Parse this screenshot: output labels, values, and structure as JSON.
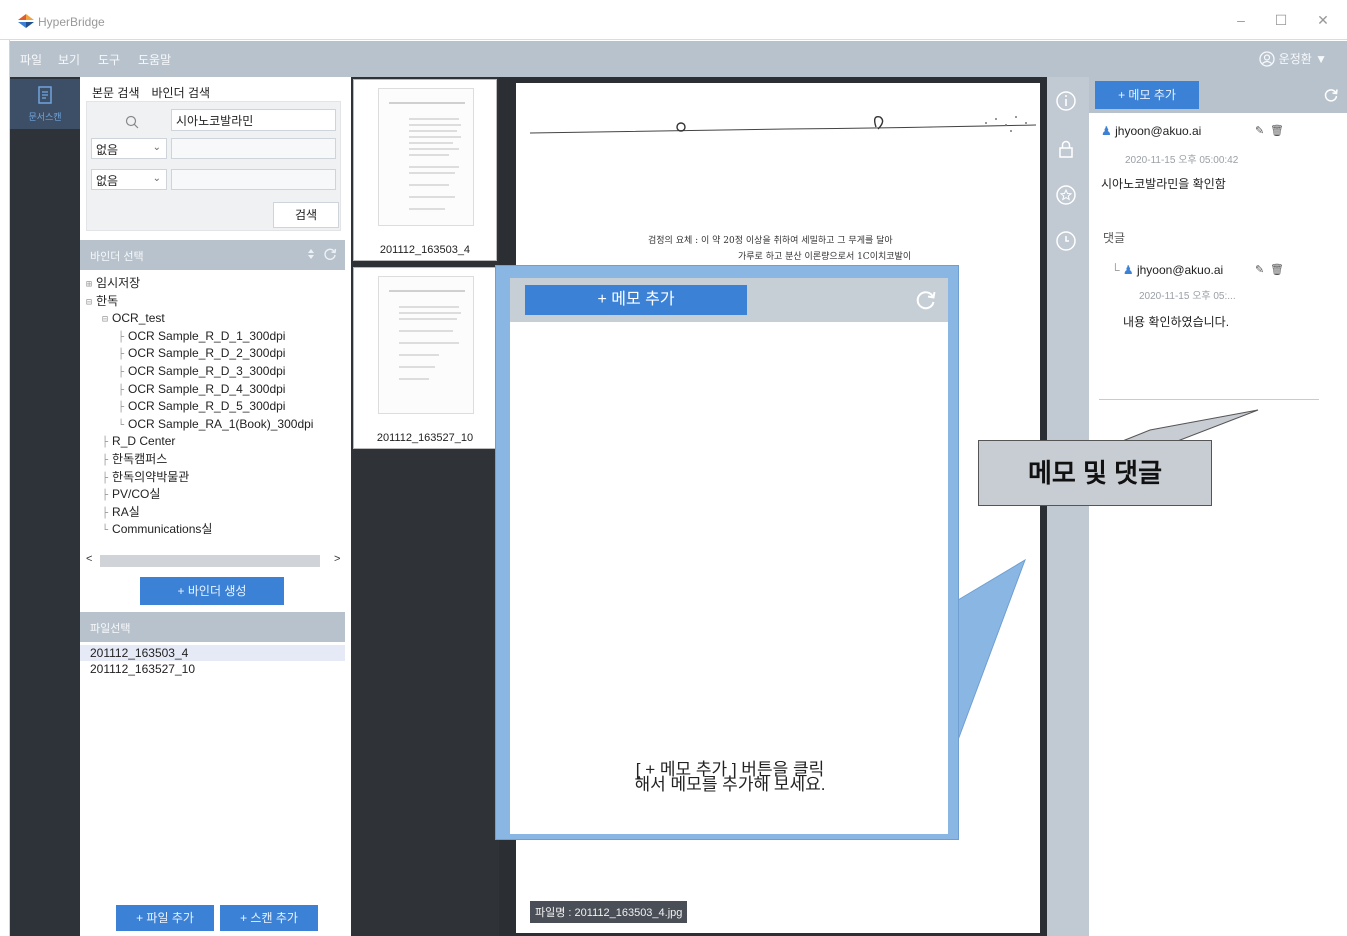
{
  "titlebar": {
    "app_title": "HyperBridge",
    "minimize": "–",
    "maximize": "☐",
    "close": "✕"
  },
  "menubar": {
    "items": [
      "파일",
      "보기",
      "도구",
      "도움말"
    ],
    "user": "운정환 ▼"
  },
  "rail": {
    "item_label": "문서스캔"
  },
  "left": {
    "tabs": [
      "본문 검색",
      "바인더 검색"
    ],
    "search_value": "시아노코발라민",
    "select1": "없음",
    "select2": "없음",
    "search_button": "검색",
    "binder_header": "바인더 선택",
    "tree": [
      {
        "indent": 0,
        "guide": "⊞",
        "label": "임시저장"
      },
      {
        "indent": 0,
        "guide": "⊟",
        "label": "한독"
      },
      {
        "indent": 1,
        "guide": "⊟",
        "label": "OCR_test"
      },
      {
        "indent": 2,
        "guide": "├",
        "label": "OCR Sample_R_D_1_300dpi"
      },
      {
        "indent": 2,
        "guide": "├",
        "label": "OCR Sample_R_D_2_300dpi"
      },
      {
        "indent": 2,
        "guide": "├",
        "label": "OCR Sample_R_D_3_300dpi"
      },
      {
        "indent": 2,
        "guide": "├",
        "label": "OCR Sample_R_D_4_300dpi"
      },
      {
        "indent": 2,
        "guide": "├",
        "label": "OCR Sample_R_D_5_300dpi"
      },
      {
        "indent": 2,
        "guide": "└",
        "label": "OCR Sample_RA_1(Book)_300dpi"
      },
      {
        "indent": 1,
        "guide": "├",
        "label": "R_D Center"
      },
      {
        "indent": 1,
        "guide": "├",
        "label": "한독캠퍼스"
      },
      {
        "indent": 1,
        "guide": "├",
        "label": "한독의약박물관"
      },
      {
        "indent": 1,
        "guide": "├",
        "label": "PV/CO실"
      },
      {
        "indent": 1,
        "guide": "├",
        "label": "RA실"
      },
      {
        "indent": 1,
        "guide": "└",
        "label": "Communications실"
      }
    ],
    "binder_create": "+ 바인더 생성",
    "file_header": "파일선택",
    "files": [
      "201112_163503_4",
      "201112_163527_10"
    ],
    "add_file": "+ 파일 추가",
    "add_scan": "+ 스캔 추가"
  },
  "thumbs": [
    "201112_163503_4",
    "201112_163527_10"
  ],
  "viewer": {
    "filename": "파일명 : 201112_163503_4.jpg",
    "doc_lines": [
      "검정의 요체  : 이 약 20정 이상을 취하여 세밀하고 그 무게를 달아",
      "가루로 하고 분산 이론량으로서 1C이치코발이"
    ]
  },
  "memo": {
    "add_button": "+ 메모 추가",
    "author": "jhyoon@akuo.ai",
    "date": "2020-11-15 오후 05:00:42",
    "text": "시아노코발라민을 확인함",
    "comment_header": "댓글",
    "reply_author": "jhyoon@akuo.ai",
    "reply_date": "2020-11-15 오후 05:...",
    "reply_text": "내용 확인하였습니다."
  },
  "zoom": {
    "add_button": "+ 메모 추가",
    "hint_line1": "[ + 메모 추가 ] 버튼을 클릭",
    "hint_line2": "해서 메모를 추가해 보세요."
  },
  "callout_label": "메모 및 댓글",
  "colors": {
    "accent": "#3b82d6",
    "menubar": "#b8c2cc",
    "rail": "#2e333a",
    "callout": "#8ab6e3"
  }
}
